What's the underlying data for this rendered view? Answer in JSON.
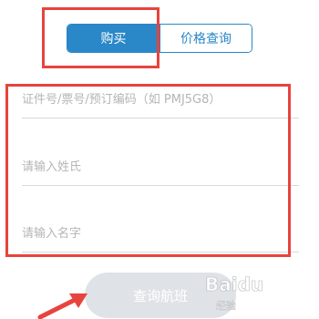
{
  "tabs": {
    "buy_label": "购买",
    "price_query_label": "价格查询",
    "active": "buy"
  },
  "form": {
    "id_placeholder": "证件号/票号/预订编码（如 PMJ5G8）",
    "surname_placeholder": "请输入姓氏",
    "given_name_placeholder": "请输入名字"
  },
  "search_button_label": "查询航班",
  "watermark": {
    "logo": "Baidu",
    "sub": "经验"
  },
  "colors": {
    "primary": "#2a87c8",
    "highlight": "#e8433d",
    "button_disabled": "#dfe3e8"
  }
}
